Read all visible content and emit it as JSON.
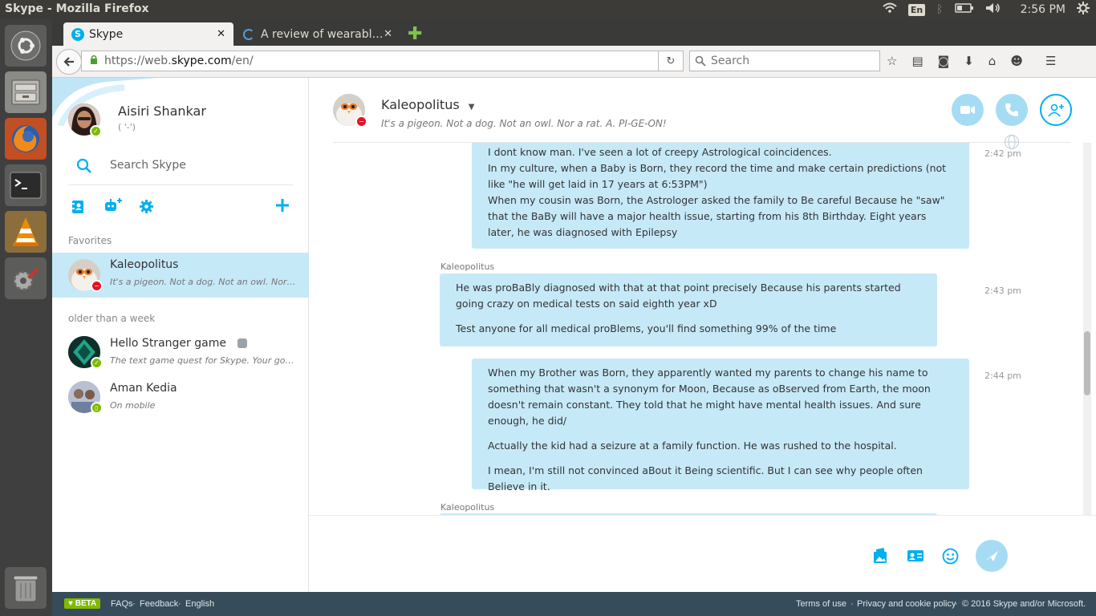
{
  "system": {
    "window_title": "Skype - Mozilla Firefox",
    "keyboard_layout": "En",
    "clock": "2:56 PM"
  },
  "browser": {
    "tabs": [
      {
        "label": "Skype",
        "active": true
      },
      {
        "label": "A review of wearabl…",
        "active": false
      }
    ],
    "url_prefix": "https://web.",
    "url_host": "skype.com",
    "url_path": "/en/",
    "search_placeholder": "Search"
  },
  "profile": {
    "name": "Aisiri Shankar",
    "mood": "( '-')"
  },
  "sidebar": {
    "search_placeholder": "Search Skype",
    "favorites_header": "Favorites",
    "older_header": "older than a week",
    "favorites": [
      {
        "name": "Kaleopolitus",
        "mood": "It's a pigeon. Not a dog. Not an owl. Nor a rat. A. PI-GE-ON!"
      }
    ],
    "older": [
      {
        "name": "Hello Stranger game",
        "mood": "The text game quest for Skype. Your goal is to find the stranger."
      },
      {
        "name": "Aman Kedia",
        "mood": "On mobile"
      }
    ]
  },
  "chat": {
    "contact_name": "Kaleopolitus",
    "contact_mood": "It's a pigeon. Not a dog. Not an owl. Nor a rat. A. PI-GE-ON!",
    "messages": [
      {
        "time": "2:42 pm",
        "paragraphs": [
          "I dont know man. I've seen a lot of creepy Astrological coincidences.",
          "In my culture, when a Baby is Born, they record the time and make certain predictions (not like \"he will get laid in 17 years at 6:53PM\")",
          "When my cousin was Born, the Astrologer asked the family to Be careful Because he \"saw\" that the BaBy will have a major health issue, starting from his 8th Birthday. Eight years later, he was diagnosed with Epilepsy"
        ]
      },
      {
        "sender": "Kaleopolitus",
        "time": "2:43 pm",
        "paragraphs": [
          "He was proBaBly diagnosed with that at that point precisely Because his parents started going crazy on medical tests on said eighth year xD",
          "Test anyone for all medical proBlems, you'll find something 99% of the time"
        ]
      },
      {
        "time": "2:44 pm",
        "paragraphs": [
          "When my Brother was Born, they apparently wanted my parents to change his name to something that wasn't a synonym for Moon, Because as oBserved from Earth, the moon doesn't remain constant. They told that he might have mental health issues. And sure enough, he did/",
          "Actually the kid had a seizure at a family function. He was rushed to the hospital.",
          "I mean, I'm still not convinced aBout it Being scientific. But I can see why people often Believe in it."
        ]
      }
    ],
    "next_sender": "Kaleopolitus"
  },
  "footer": {
    "beta": "BETA",
    "links": [
      "FAQs",
      "Feedback",
      "English"
    ],
    "separator": "·",
    "terms": "Terms of use",
    "privacy": "Privacy and cookie policy",
    "copyright": "© 2016 Skype and/or Microsoft."
  }
}
